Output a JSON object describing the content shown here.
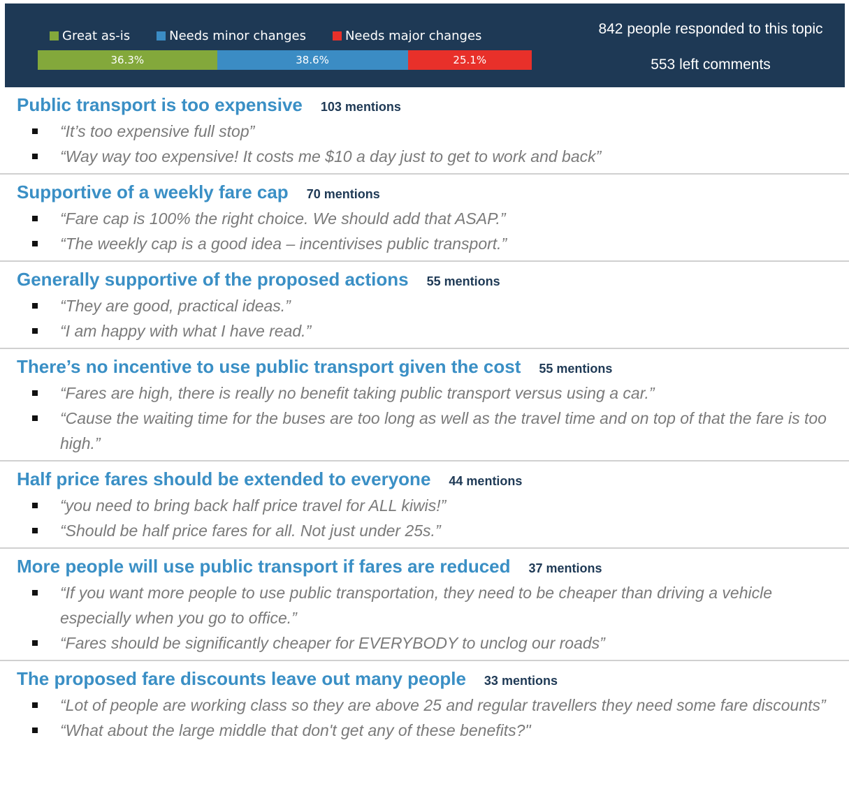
{
  "header": {
    "legend": [
      {
        "label": "Great as-is",
        "color": "#83a83b"
      },
      {
        "label": "Needs minor changes",
        "color": "#3b8cc4"
      },
      {
        "label": "Needs major changes",
        "color": "#e8302a"
      }
    ],
    "bar": [
      {
        "label": "36.3%",
        "value": 36.3,
        "color": "#83a83b"
      },
      {
        "label": "38.6%",
        "value": 38.6,
        "color": "#3b8cc4"
      },
      {
        "label": "25.1%",
        "value": 25.1,
        "color": "#e8302a"
      }
    ],
    "respondents": "842 people responded to this topic",
    "comments": "553 left comments"
  },
  "topics": [
    {
      "title": "Public transport is too expensive",
      "count": "103 mentions",
      "quotes": [
        "“It’s too expensive full stop”",
        "“Way way too expensive! It costs me $10 a day just to get to work and back”"
      ]
    },
    {
      "title": "Supportive of a weekly fare cap",
      "count": "70 mentions",
      "quotes": [
        "“Fare cap is 100% the right choice. We should add that ASAP.”",
        "“The weekly cap is a good idea – incentivises public transport.”"
      ]
    },
    {
      "title": "Generally supportive of the proposed actions",
      "count": "55 mentions",
      "quotes": [
        "“They are good, practical ideas.”",
        "“I am happy with what I have read.”"
      ]
    },
    {
      "title": "There’s no incentive to use public transport given the cost",
      "count": "55 mentions",
      "quotes": [
        "“Fares are high, there is really no benefit taking public transport versus using a car.”",
        "“Cause the waiting time for the buses are too long as well as the travel time and on top of that the fare is too high.”"
      ]
    },
    {
      "title": "Half price fares should be extended to everyone",
      "count": "44 mentions",
      "quotes": [
        "“you need to bring back half price travel for ALL kiwis!”",
        "“Should be half price fares for all. Not just under 25s.”"
      ]
    },
    {
      "title": "More people will use public transport if fares are reduced",
      "count": "37 mentions",
      "quotes": [
        "“If you want more people to use public transportation, they need to be cheaper than driving a vehicle especially when you go to office.”",
        "“Fares should be significantly cheaper for EVERYBODY to unclog our roads”"
      ]
    },
    {
      "title": "The proposed fare discounts leave out many people",
      "count": "33 mentions",
      "quotes": [
        "“Lot of people are working class so they are above 25 and regular travellers they need some fare discounts”",
        "“What about the large middle that don't get any of these benefits?\""
      ]
    }
  ]
}
